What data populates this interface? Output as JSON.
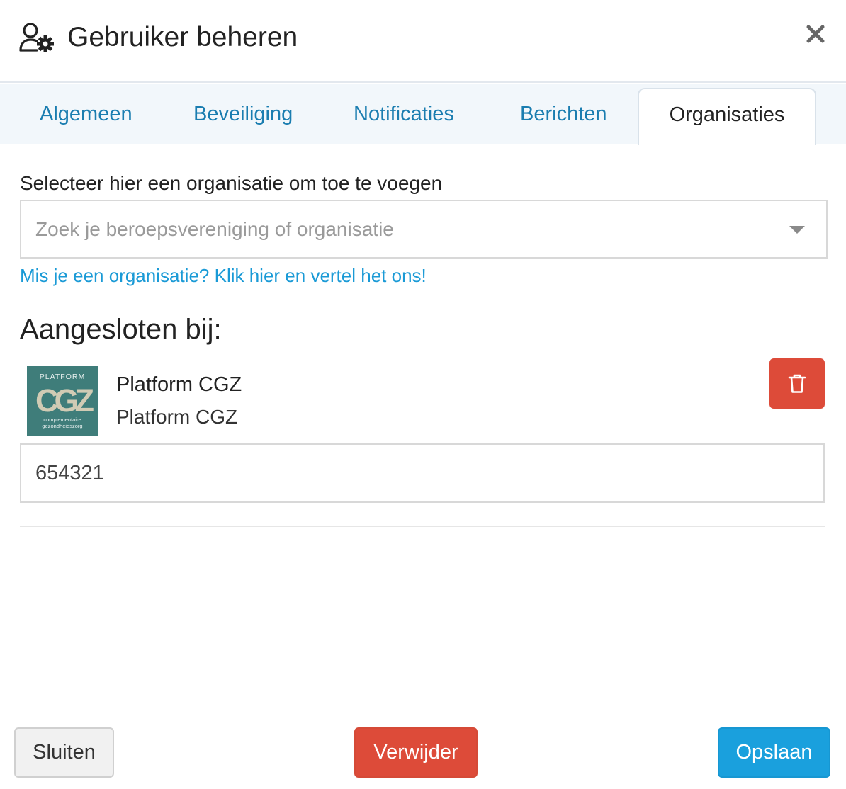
{
  "header": {
    "title": "Gebruiker beheren",
    "icon": "user-gear-icon",
    "close_icon": "close-icon"
  },
  "tabs": [
    {
      "label": "Algemeen",
      "active": false
    },
    {
      "label": "Beveiliging",
      "active": false
    },
    {
      "label": "Notificaties",
      "active": false
    },
    {
      "label": "Berichten",
      "active": false
    },
    {
      "label": "Organisaties",
      "active": true
    }
  ],
  "organisation_select": {
    "label": "Selecteer hier een organisatie om toe te voegen",
    "placeholder": "Zoek je beroepsvereniging of organisatie",
    "missing_link": "Mis je een organisatie? Klik hier en vertel het ons!"
  },
  "affiliations": {
    "heading": "Aangesloten bij:",
    "items": [
      {
        "name": "Platform CGZ",
        "subtitle": "Platform CGZ",
        "member_number": "654321",
        "logo": {
          "top_text": "PLATFORM",
          "letters": "CGZ",
          "bottom_line_1": "complementaire",
          "bottom_line_2": "gezondheidszorg"
        },
        "delete_icon": "trash-icon"
      }
    ]
  },
  "footer": {
    "close_label": "Sluiten",
    "delete_label": "Verwijder",
    "save_label": "Opslaan"
  },
  "colors": {
    "link": "#1a7db0",
    "danger": "#dd4b39",
    "primary": "#1aa0dd",
    "logo_bg": "#3f7d7a"
  }
}
